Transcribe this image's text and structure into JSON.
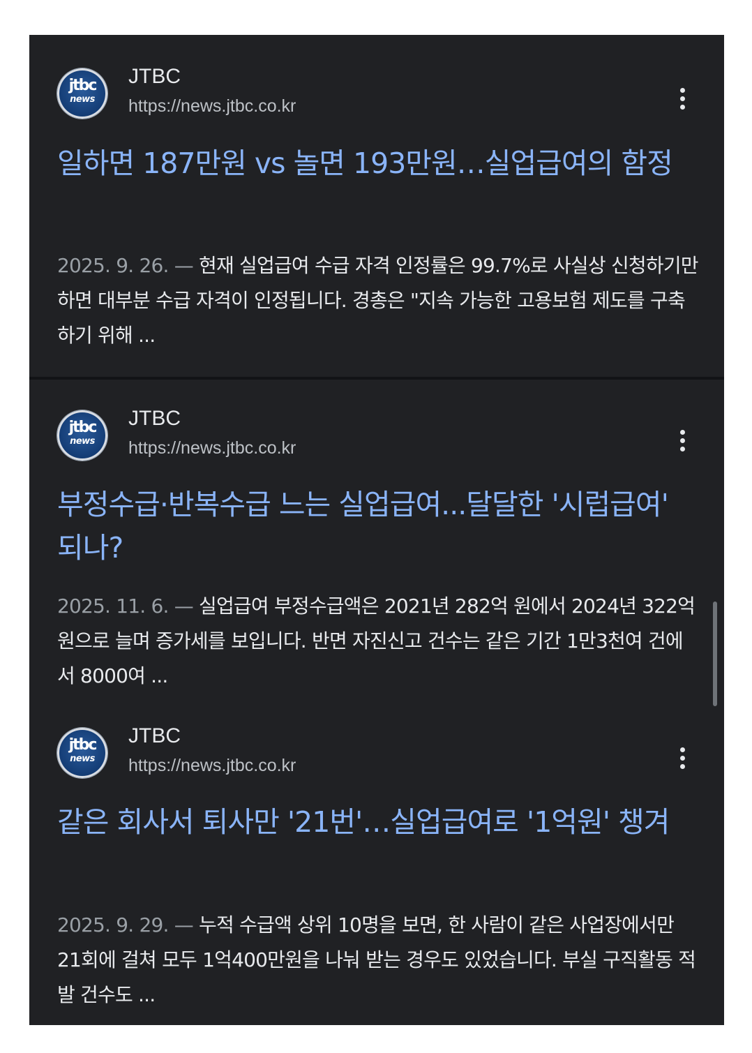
{
  "results": [
    {
      "logo": {
        "line1": "jtbc",
        "line2": "news"
      },
      "source": "JTBC",
      "url": "https://news.jtbc.co.kr",
      "title": "일하면 187만원 vs 놀면 193만원…실업급여의 함정",
      "date": "2025. 9. 26. —",
      "snippet": "현재 실업급여 수급 자격 인정률은 99.7%로 사실상 신청하기만 하면 대부분 수급 자격이 인정됩니다. 경총은 \"지속 가능한 고용보험 제도를 구축하기 위해 ..."
    },
    {
      "logo": {
        "line1": "jtbc",
        "line2": "news"
      },
      "source": "JTBC",
      "url": "https://news.jtbc.co.kr",
      "title": "부정수급·반복수급 느는 실업급여...달달한 '시럽급여' 되나?",
      "date": "2025. 11. 6. —",
      "snippet": "실업급여 부정수급액은 2021년 282억 원에서 2024년 322억 원으로 늘며 증가세를 보입니다. 반면 자진신고 건수는 같은 기간 1만3천여 건에서 8000여 ..."
    },
    {
      "logo": {
        "line1": "jtbc",
        "line2": "news"
      },
      "source": "JTBC",
      "url": "https://news.jtbc.co.kr",
      "title": "같은 회사서 퇴사만 '21번'…실업급여로 '1억원' 챙겨",
      "date": "2025. 9. 29. —",
      "snippet": "누적 수급액 상위 10명을 보면, 한 사람이 같은 사업장에서만 21회에 걸쳐 모두 1억400만원을 나눠 받는 경우도 있었습니다. 부실 구직활동 적발 건수도 ..."
    }
  ],
  "icons": {
    "more": "more-vert-icon",
    "logo": "jtbc-news-logo"
  },
  "colors": {
    "background": "#202124",
    "title": "#8ab4f8",
    "text": "#e8eaed",
    "muted": "#9aa0a6"
  }
}
